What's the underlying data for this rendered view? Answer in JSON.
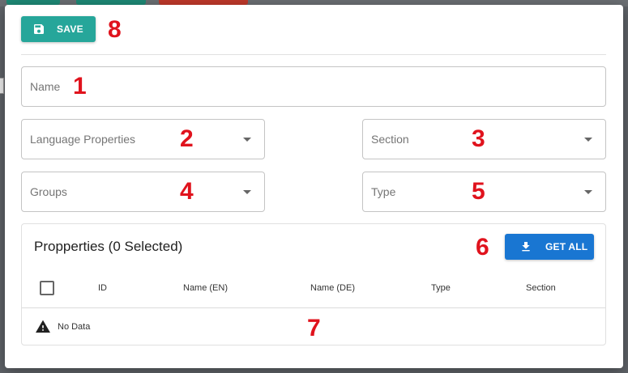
{
  "toolbar": {
    "save_label": "SAVE"
  },
  "form": {
    "name_placeholder": "Name",
    "language_properties_placeholder": "Language Properties",
    "section_placeholder": "Section",
    "groups_placeholder": "Groups",
    "type_placeholder": "Type"
  },
  "properties": {
    "title": "Propperties (0 Selected)",
    "get_all_label": "GET ALL",
    "columns": [
      "ID",
      "Name (EN)",
      "Name (DE)",
      "Type",
      "Section"
    ],
    "empty_text": "No Data"
  },
  "markers": [
    "1",
    "2",
    "3",
    "4",
    "5",
    "6",
    "7",
    "8"
  ],
  "colors": {
    "save_button": "#26a69a",
    "get_all_button": "#1976d2",
    "marker": "#e0131d"
  },
  "icons": {
    "save": "floppy-disk-icon",
    "get_all": "download-icon",
    "empty": "warning-icon",
    "select": "caret-down-icon"
  }
}
